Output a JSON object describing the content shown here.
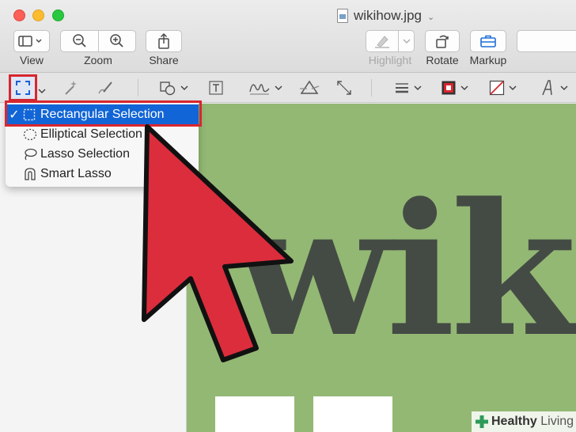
{
  "window": {
    "title": "wikihow.jpg",
    "title_chevron": "⌄"
  },
  "toolbar": {
    "view_label": "View",
    "zoom_label": "Zoom",
    "share_label": "Share",
    "highlight_label": "Highlight",
    "rotate_label": "Rotate",
    "markup_label": "Markup"
  },
  "menu": {
    "items": [
      {
        "label": "Rectangular Selection",
        "checked": true,
        "icon": "rect-dashed-icon"
      },
      {
        "label": "Elliptical Selection",
        "checked": false,
        "icon": "ellipse-dashed-icon"
      },
      {
        "label": "Lasso Selection",
        "checked": false,
        "icon": "lasso-icon"
      },
      {
        "label": "Smart Lasso",
        "checked": false,
        "icon": "smart-lasso-icon"
      }
    ],
    "check_glyph": "✓"
  },
  "canvas": {
    "image_text": "wik"
  },
  "watermark": {
    "brand_bold": "Healthy",
    "brand_light": "Living"
  },
  "colors": {
    "annotation_red": "#d8262f",
    "selection_blue": "#1265d6",
    "canvas_green": "#93b874"
  }
}
